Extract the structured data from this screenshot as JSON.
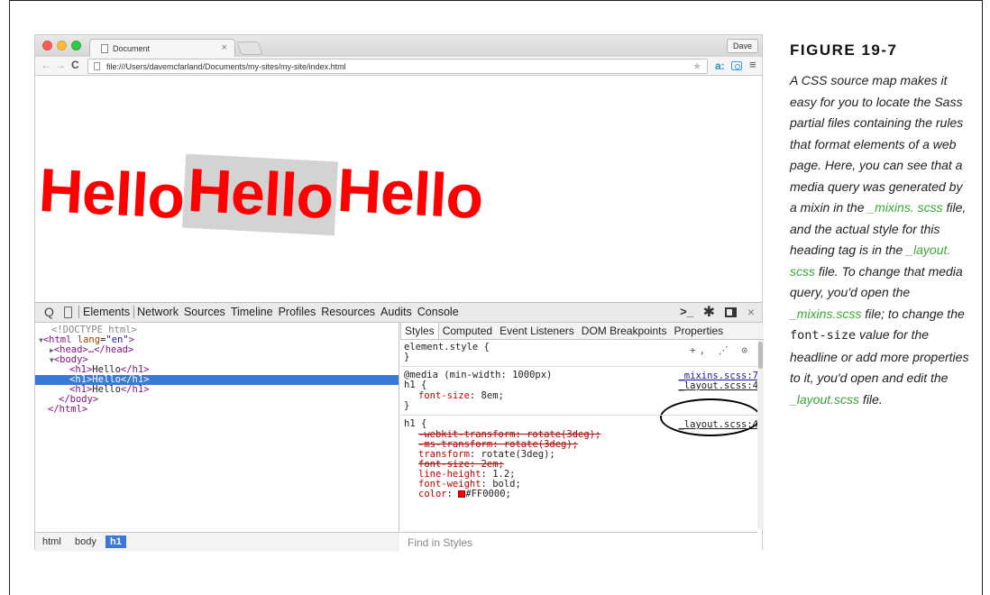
{
  "browser": {
    "tab_title": "Document",
    "tab_close": "×",
    "profile_label": "Dave",
    "nav_back": "←",
    "nav_forward": "→",
    "nav_reload": "C",
    "url": "file:///Users/davemcfarland/Documents/my-sites/my-site/index.html",
    "star": "★",
    "amazon_ext": "a:",
    "menu": "≡"
  },
  "page": {
    "headings": [
      "Hello",
      "Hello",
      "Hello"
    ]
  },
  "devtools": {
    "search_icon": "Q",
    "tabs": [
      "Elements",
      "Network",
      "Sources",
      "Timeline",
      "Profiles",
      "Resources",
      "Audits",
      "Console"
    ],
    "console_icon": ">_",
    "gear_icon": "✱",
    "close_icon": "×",
    "dom": {
      "doctype": "<!DOCTYPE html>",
      "html_open_tag": "<html",
      "html_lang_attr": "lang",
      "html_lang_value": "\"en\"",
      "html_open_end": ">",
      "head": "<head>…</head>",
      "body_open": "<body>",
      "h1_open": "<h1>",
      "h1_text": "Hello",
      "h1_close": "</h1>",
      "body_close": "</body>",
      "html_close": "</html>"
    },
    "breadcrumbs": [
      "html",
      "body",
      "h1"
    ],
    "styles_tabs": [
      "Styles",
      "Computed",
      "Event Listeners",
      "DOM Breakpoints",
      "Properties"
    ],
    "element_style": "element.style {",
    "close_brace": "}",
    "element_style_icons": "+, ⋰ ⊙",
    "media_rule": "@media (min-width: 1000px)",
    "h1_selector": "h1 {",
    "media_font_size_prop": "font-size",
    "media_font_size_val": ": 8em;",
    "media_source_1": "_mixins.scss:7",
    "media_source_2": "_layout.scss:4",
    "h1_source": "_layout.scss:4",
    "h1_props": [
      {
        "prop": "-webkit-transform",
        "val": ": rotate(3deg);"
      },
      {
        "prop": "-ms-transform",
        "val": ": rotate(3deg);"
      },
      {
        "prop": "transform",
        "val": ": rotate(3deg);"
      },
      {
        "prop": "font-size",
        "val": ": 2em;"
      },
      {
        "prop": "line-height",
        "val": ": 1.2;"
      },
      {
        "prop": "font-weight",
        "val": ": bold;"
      },
      {
        "prop": "color",
        "val": "#FF0000;"
      }
    ],
    "find_placeholder": "Find in Styles",
    "color_swatch": "#ff0000"
  },
  "caption": {
    "figure": "FIGURE 19-7",
    "text_1": "A CSS source map makes it easy for you to locate the Sass partial files containing the rules that format elements of a web page. Here, you can see that a media query was generated by a mixin in the ",
    "link_mixins": "_mixins. scss",
    "text_2": " file, and the actual style for this heading tag is in the ",
    "link_layout": "_layout. scss",
    "text_3": " file. To change that media query,  you'd open the ",
    "link_mixins_2": "_mixins.scss",
    "text_4": " file; to change the ",
    "code_font_size": "font-size",
    "text_5": " value for the headline or add more properties to it, you'd open and edit the ",
    "link_layout_2": "_layout.scss",
    "text_6": " file."
  }
}
